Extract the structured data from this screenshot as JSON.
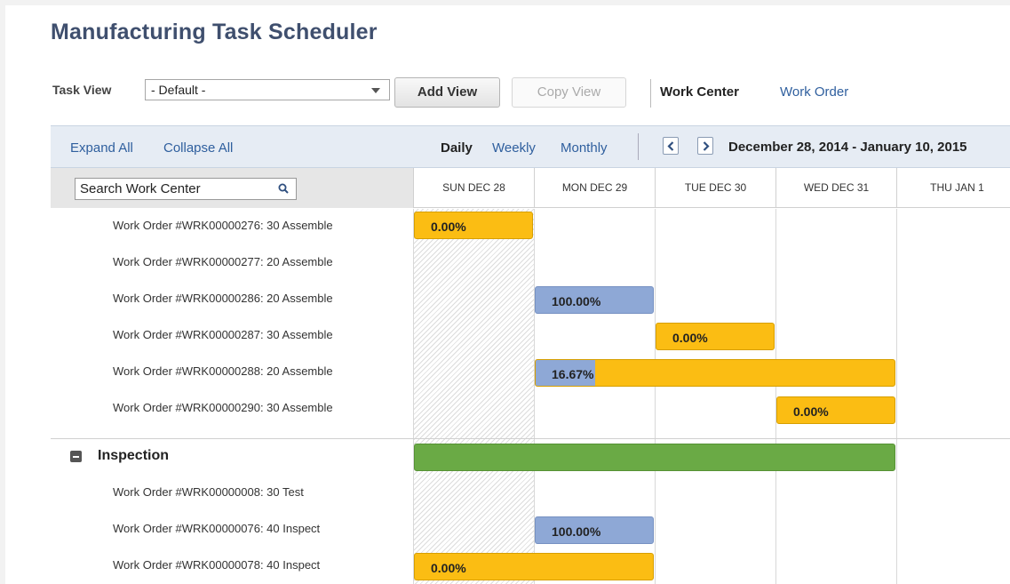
{
  "page": {
    "title": "Manufacturing Task Scheduler"
  },
  "toolbar": {
    "task_view_label": "Task View",
    "task_view_value": "- Default -",
    "add_view_label": "Add View",
    "copy_view_label": "Copy View",
    "work_center_label": "Work Center",
    "work_order_label": "Work Order"
  },
  "scheduler": {
    "expand_all": "Expand All",
    "collapse_all": "Collapse All",
    "daily": "Daily",
    "weekly": "Weekly",
    "monthly": "Monthly",
    "date_range": "December 28, 2014 - January 10, 2015",
    "search_placeholder": "Search Work Center",
    "days": [
      "SUN DEC 28",
      "MON DEC 29",
      "TUE DEC 30",
      "WED DEC 31",
      "THU JAN 1"
    ]
  },
  "rows": [
    {
      "label": "Work Order #WRK00000276: 30 Assemble",
      "bar": {
        "text": "0.00%",
        "percent": 0,
        "color": "#fbbd13"
      }
    },
    {
      "label": "Work Order #WRK00000277: 20 Assemble"
    },
    {
      "label": "Work Order #WRK00000286: 20 Assemble",
      "bar": {
        "text": "100.00%",
        "percent": 100,
        "color": "#8ea8d6"
      }
    },
    {
      "label": "Work Order #WRK00000287: 30 Assemble",
      "bar": {
        "text": "0.00%",
        "percent": 0,
        "color": "#fbbd13"
      }
    },
    {
      "label": "Work Order #WRK00000288: 20 Assemble",
      "bar": {
        "text": "16.67%",
        "percent": 16.67,
        "color": "#fbbd13"
      }
    },
    {
      "label": "Work Order #WRK00000290: 30 Assemble",
      "bar": {
        "text": "0.00%",
        "percent": 0,
        "color": "#fbbd13"
      }
    }
  ],
  "group": {
    "label": "Inspection",
    "bar_color": "#6aaa45"
  },
  "group_rows": [
    {
      "label": "Work Order #WRK00000008: 30 Test"
    },
    {
      "label": "Work Order #WRK00000076: 40 Inspect",
      "bar": {
        "text": "100.00%",
        "percent": 100,
        "color": "#8ea8d6"
      }
    },
    {
      "label": "Work Order #WRK00000078: 40 Inspect",
      "bar": {
        "text": "0.00%",
        "percent": 0,
        "color": "#fbbd13"
      }
    }
  ]
}
